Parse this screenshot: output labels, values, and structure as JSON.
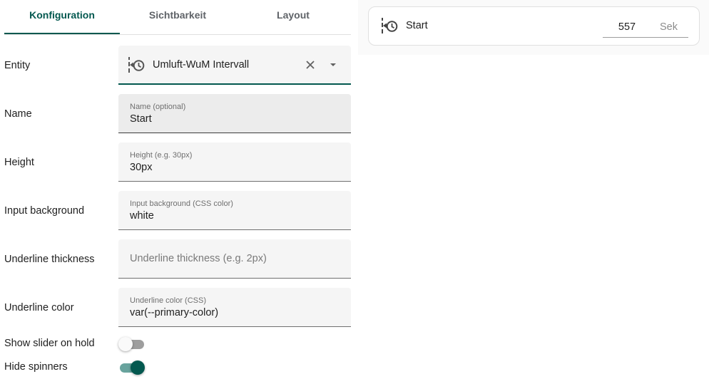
{
  "tabs": [
    "Konfiguration",
    "Sichtbarkeit",
    "Layout"
  ],
  "entity": {
    "label": "Entity",
    "value": "Umluft-WuM Intervall",
    "icon": "timer-history-icon"
  },
  "name": {
    "label": "Name",
    "field_label": "Name (optional)",
    "value": "Start"
  },
  "height": {
    "label": "Height",
    "field_label": "Height (e.g. 30px)",
    "value": "30px"
  },
  "input_background": {
    "label": "Input background",
    "field_label": "Input background (CSS color)",
    "value": "white"
  },
  "underline_thickness": {
    "label": "Underline thickness",
    "placeholder": "Underline thickness (e.g. 2px)"
  },
  "underline_color": {
    "label": "Underline color",
    "field_label": "Underline color (CSS)",
    "value": "var(--primary-color)"
  },
  "show_slider": {
    "label": "Show slider on hold",
    "on": false
  },
  "hide_spinners": {
    "label": "Hide spinners",
    "on": true
  },
  "preview": {
    "name": "Start",
    "value": "557",
    "unit": "Sek"
  },
  "colors": {
    "accent": "#03584f",
    "accent_light": "#68a39d"
  }
}
